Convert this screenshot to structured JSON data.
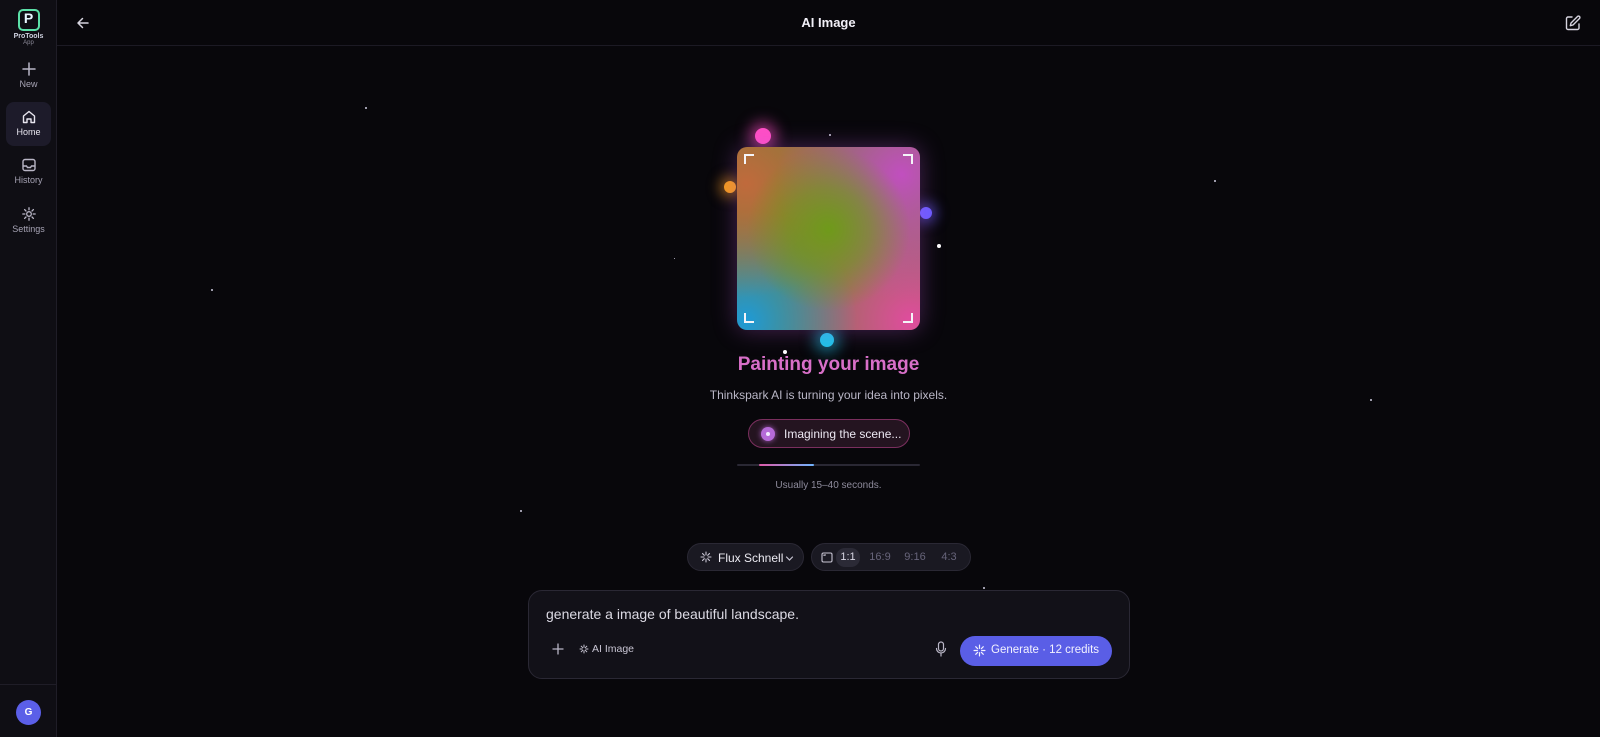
{
  "app": {
    "name": "ProTools",
    "name_sub": "App",
    "accent": "#5a5ee6"
  },
  "sidebar": {
    "items": [
      {
        "label": "New",
        "icon": "plus-icon",
        "active": false
      },
      {
        "label": "Home",
        "icon": "home-icon",
        "active": true
      },
      {
        "label": "History",
        "icon": "inbox-icon",
        "active": false
      },
      {
        "label": "Settings",
        "icon": "gear-icon",
        "active": false
      }
    ],
    "avatar_initial": "G"
  },
  "header": {
    "title": "AI Image",
    "back_icon": "arrow-left-icon",
    "edit_icon": "edit-icon"
  },
  "generation": {
    "title": "Painting your image",
    "subtitle": "Thinkspark AI is turning your idea into pixels.",
    "stage": "Imagining the scene...",
    "progress": 0.3,
    "eta": "Usually 15–40 seconds."
  },
  "toolbar": {
    "model": "Flux Schnell",
    "ratios": [
      "1:1",
      "16:9",
      "9:16",
      "4:3"
    ],
    "selected_ratio": "1:1"
  },
  "prompt": {
    "value": "generate a image of beautiful landscape.",
    "mode_label": "AI Image",
    "generate_label": "Generate · 12 credits"
  }
}
